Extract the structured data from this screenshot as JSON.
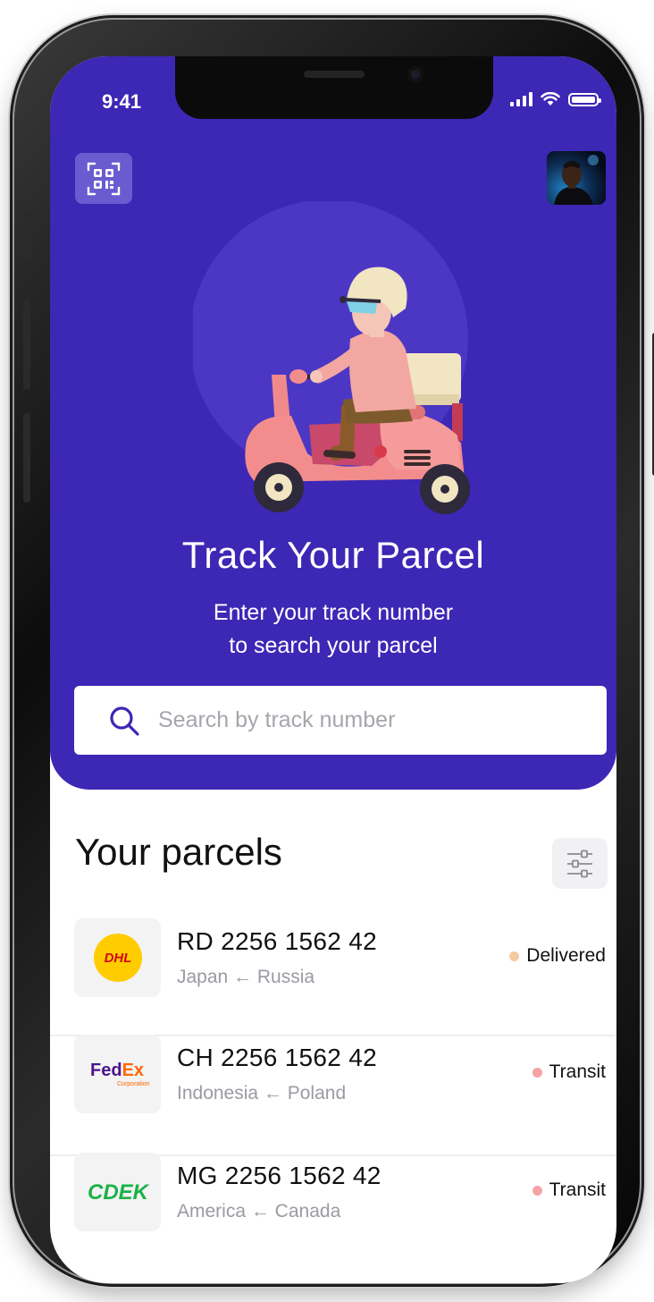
{
  "status_bar": {
    "time": "9:41"
  },
  "hero": {
    "title": "Track Your Parcel",
    "subtitle_line1": "Enter your track number",
    "subtitle_line2": "to search your parcel"
  },
  "search": {
    "placeholder": "Search by track number",
    "value": ""
  },
  "parcels_section": {
    "title": "Your parcels"
  },
  "parcels": [
    {
      "carrier": "DHL",
      "carrier_icon": "dhl-logo",
      "track_number": "RD 2256 1562 42",
      "route": "Japan ← Russia",
      "status": "Delivered",
      "status_color": "#f7c9a0"
    },
    {
      "carrier": "FedEx",
      "carrier_sub": "Corporation",
      "carrier_icon": "fedex-logo",
      "track_number": "CH 2256 1562 42",
      "route": "Indonesia ← Poland",
      "status": "Transit",
      "status_color": "#f4a3a6"
    },
    {
      "carrier": "CDEK",
      "carrier_icon": "cdek-logo",
      "track_number": "MG 2256 1562 42",
      "route": "America ← Canada",
      "status": "Transit",
      "status_color": "#f4a3a6"
    }
  ],
  "colors": {
    "header_bg": "#3d27b5",
    "qr_button_bg": "#6b5bd0",
    "search_icon": "#3d27b5",
    "delivered": "#f7c9a0",
    "transit": "#f4a3a6"
  },
  "icons": [
    "qr-scan-icon",
    "avatar",
    "search-icon",
    "filter-sliders-icon",
    "signal-icon",
    "wifi-icon",
    "battery-icon"
  ]
}
